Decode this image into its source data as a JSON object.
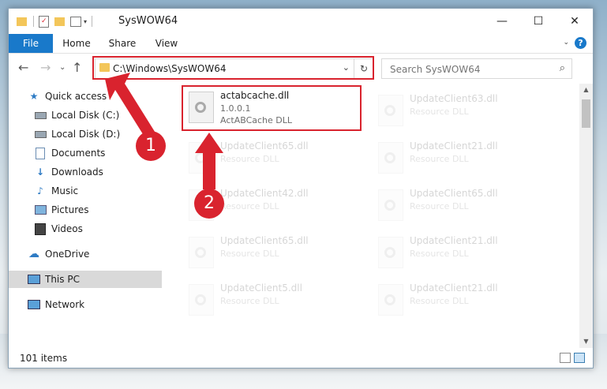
{
  "window": {
    "title": "SysWOW64",
    "minimize": "—",
    "maximize": "☐",
    "close": "✕"
  },
  "ribbon": {
    "tabs": [
      "File",
      "Home",
      "Share",
      "View"
    ],
    "help": "?"
  },
  "nav": {
    "address": "C:\\Windows\\SysWOW64",
    "search_placeholder": "Search SysWOW64"
  },
  "sidebar": {
    "items": [
      {
        "label": "Quick access",
        "icon": "star-icon"
      },
      {
        "label": "Local Disk (C:)",
        "icon": "drive-icon"
      },
      {
        "label": "Local Disk (D:)",
        "icon": "drive-icon"
      },
      {
        "label": "Documents",
        "icon": "documents-icon"
      },
      {
        "label": "Downloads",
        "icon": "download-icon"
      },
      {
        "label": "Music",
        "icon": "music-icon"
      },
      {
        "label": "Pictures",
        "icon": "pictures-icon"
      },
      {
        "label": "Videos",
        "icon": "videos-icon"
      },
      {
        "label": "OneDrive",
        "icon": "cloud-icon"
      },
      {
        "label": "This PC",
        "icon": "computer-icon"
      },
      {
        "label": "Network",
        "icon": "network-icon"
      }
    ]
  },
  "files": {
    "highlighted": {
      "name": "actabcache.dll",
      "version": "1.0.0.1",
      "description": "ActABCache DLL"
    },
    "faded": [
      {
        "name": "UpdateClient63.dll",
        "type": "Resource DLL"
      },
      {
        "name": "UpdateClient65.dll",
        "type": "Resource DLL"
      },
      {
        "name": "UpdateClient21.dll",
        "type": "Resource DLL"
      },
      {
        "name": "UpdateClient42.dll",
        "type": "Resource DLL"
      },
      {
        "name": "UpdateClient65.dll",
        "type": "Resource DLL"
      },
      {
        "name": "UpdateClient65.dll",
        "type": "Resource DLL"
      },
      {
        "name": "UpdateClient21.dll",
        "type": "Resource DLL"
      },
      {
        "name": "UpdateClient5.dll",
        "type": "Resource DLL"
      },
      {
        "name": "UpdateClient21.dll",
        "type": "Resource DLL"
      }
    ]
  },
  "status": {
    "count": "101 items"
  },
  "annotations": {
    "step1": "1",
    "step2": "2",
    "color": "#d9232e"
  }
}
